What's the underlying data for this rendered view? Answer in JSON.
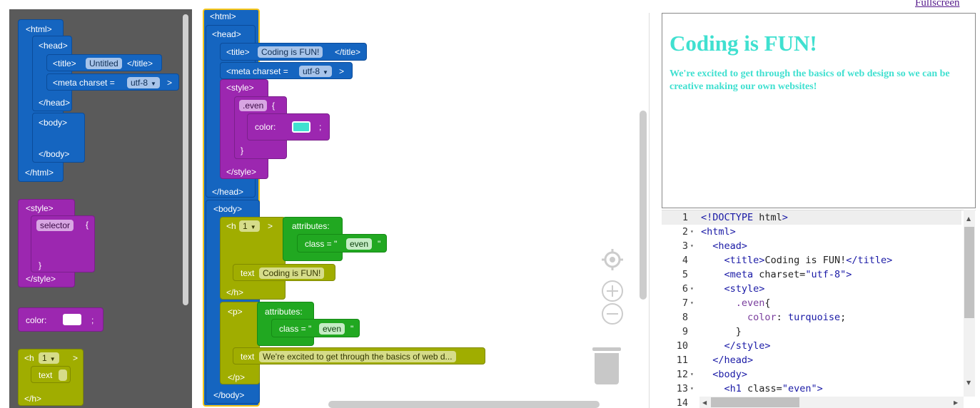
{
  "toolbox": {
    "html_block": {
      "open": "<html>",
      "head_open": "<head>",
      "title_open": "<title>",
      "title_value": "Untitled",
      "title_close": "</title>",
      "meta_prefix": "<meta charset =",
      "meta_value": "utf-8",
      "meta_suffix": ">",
      "head_close": "</head>",
      "body_open": "<body>",
      "body_close": "</body>",
      "close": "</html>"
    },
    "style_block": {
      "open": "<style>",
      "selector": "selector",
      "brace_open": "{",
      "brace_close": "}",
      "close": "</style>"
    },
    "color_block": {
      "label": "color:",
      "semicolon": ";"
    },
    "h_block": {
      "open": "<h",
      "level": "1",
      "gt": ">",
      "text_label": "text",
      "close": "</h>"
    }
  },
  "workspace": {
    "html_open": "<html>",
    "head_open": "<head>",
    "title_open": "<title>",
    "title_value": "Coding is FUN!",
    "title_close": "</title>",
    "meta_prefix": "<meta charset =",
    "meta_value": "utf-8",
    "meta_suffix": ">",
    "style_open": "<style>",
    "selector_value": ".even",
    "brace_open": "{",
    "color_label": "color:",
    "color_value": "#40e0d0",
    "semicolon": ";",
    "brace_close": "}",
    "style_close": "</style>",
    "head_close": "</head>",
    "body_open": "<body>",
    "h_open": "<h",
    "h_level": "1",
    "h_gt": ">",
    "attributes_label": "attributes:",
    "class_prefix": "class = \"",
    "class_value": "even",
    "class_suffix": "\"",
    "h_text_label": "text",
    "h_text_value": "Coding is FUN!",
    "h_close": "</h>",
    "p_open": "<p>",
    "p_text_label": "text",
    "p_text_value": "We're excited to get through the basics of web d...",
    "p_close": "</p>",
    "body_close": "</body>"
  },
  "controls": {
    "center_icon": "target-icon",
    "zoom_in_icon": "plus-circle-icon",
    "zoom_out_icon": "minus-circle-icon",
    "trash_icon": "trash-icon"
  },
  "preview": {
    "fullscreen_label": "Fullscreen",
    "heading": "Coding is FUN!",
    "paragraph": "We're excited to get through the basics of web design so we can be creative making our own websites!",
    "accent_color": "#40e0d0"
  },
  "editor": {
    "lines": [
      {
        "n": "1",
        "fold": "",
        "code": "<!DOCTYPE html>"
      },
      {
        "n": "2",
        "fold": "▾",
        "code": "<html>"
      },
      {
        "n": "3",
        "fold": "▾",
        "code": "  <head>"
      },
      {
        "n": "4",
        "fold": "",
        "code": "    <title>Coding is FUN!</title>"
      },
      {
        "n": "5",
        "fold": "",
        "code": "    <meta charset=\"utf-8\">"
      },
      {
        "n": "6",
        "fold": "▾",
        "code": "    <style>"
      },
      {
        "n": "7",
        "fold": "▾",
        "code": "      .even{"
      },
      {
        "n": "8",
        "fold": "",
        "code": "        color: turquoise;"
      },
      {
        "n": "9",
        "fold": "",
        "code": "      }"
      },
      {
        "n": "10",
        "fold": "",
        "code": "    </style>"
      },
      {
        "n": "11",
        "fold": "",
        "code": "  </head>"
      },
      {
        "n": "12",
        "fold": "▾",
        "code": "  <body>"
      },
      {
        "n": "13",
        "fold": "▾",
        "code": "    <h1 class=\"even\">"
      },
      {
        "n": "14",
        "fold": "",
        "code": ""
      }
    ]
  }
}
